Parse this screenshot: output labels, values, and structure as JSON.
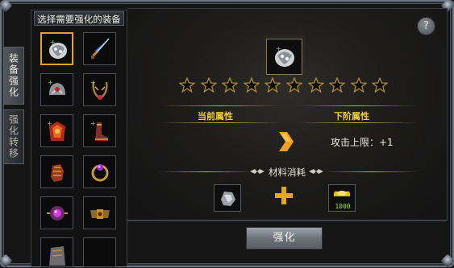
{
  "tabs": [
    {
      "label": "装备强化"
    },
    {
      "label": "强化转移"
    }
  ],
  "item_panel": {
    "title": "选择需要强化的装备"
  },
  "help": {
    "label": "?"
  },
  "stars": {
    "total": 10,
    "filled": 0
  },
  "attributes": {
    "current_header": "当前属性",
    "next_header": "下阶属性",
    "next_value": "攻击上限：+1"
  },
  "materials": {
    "title": "材料消耗",
    "gold_amount": "1000"
  },
  "enhance_button": {
    "label": "强化"
  },
  "colors": {
    "accent_gold": "#f0cf3c",
    "arrow_orange": "#f0a020",
    "selected_border": "#d9a52a"
  },
  "icons": {
    "slots": [
      "armor-icon",
      "sword-icon",
      "helmet-icon",
      "necklace-icon",
      "robe-icon",
      "boots-icon",
      "gauntlet-icon",
      "ring-icon",
      "amulet-icon",
      "belt-icon",
      "bracer-icon",
      "empty-slot"
    ],
    "preview": "armor-icon",
    "material": "ore-icon",
    "gold": "gold-ingot-icon",
    "arrow": "chevron-right-icon"
  }
}
